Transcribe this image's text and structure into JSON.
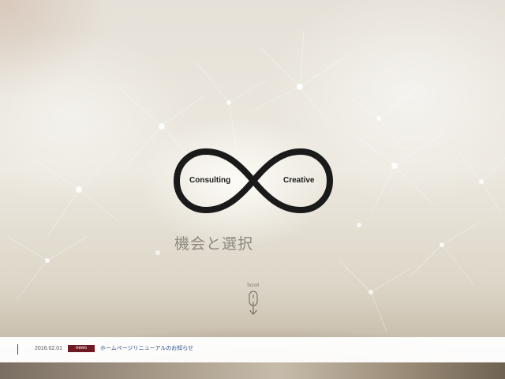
{
  "hero": {
    "logo_left_text": "Consulting",
    "logo_right_text": "Creative",
    "tagline": "機会と選択"
  },
  "scroll": {
    "label": "Scroll",
    "icon": "mouse-scroll-icon"
  },
  "news": {
    "date": "2016.02.01",
    "badge": "news",
    "title": "ホームページリニューアルのお知らせ",
    "badge_color": "#6e1b23",
    "link_color": "#2a4f87"
  },
  "colors": {
    "logo": "#1a1a1a",
    "tagline": "#8e8881"
  }
}
